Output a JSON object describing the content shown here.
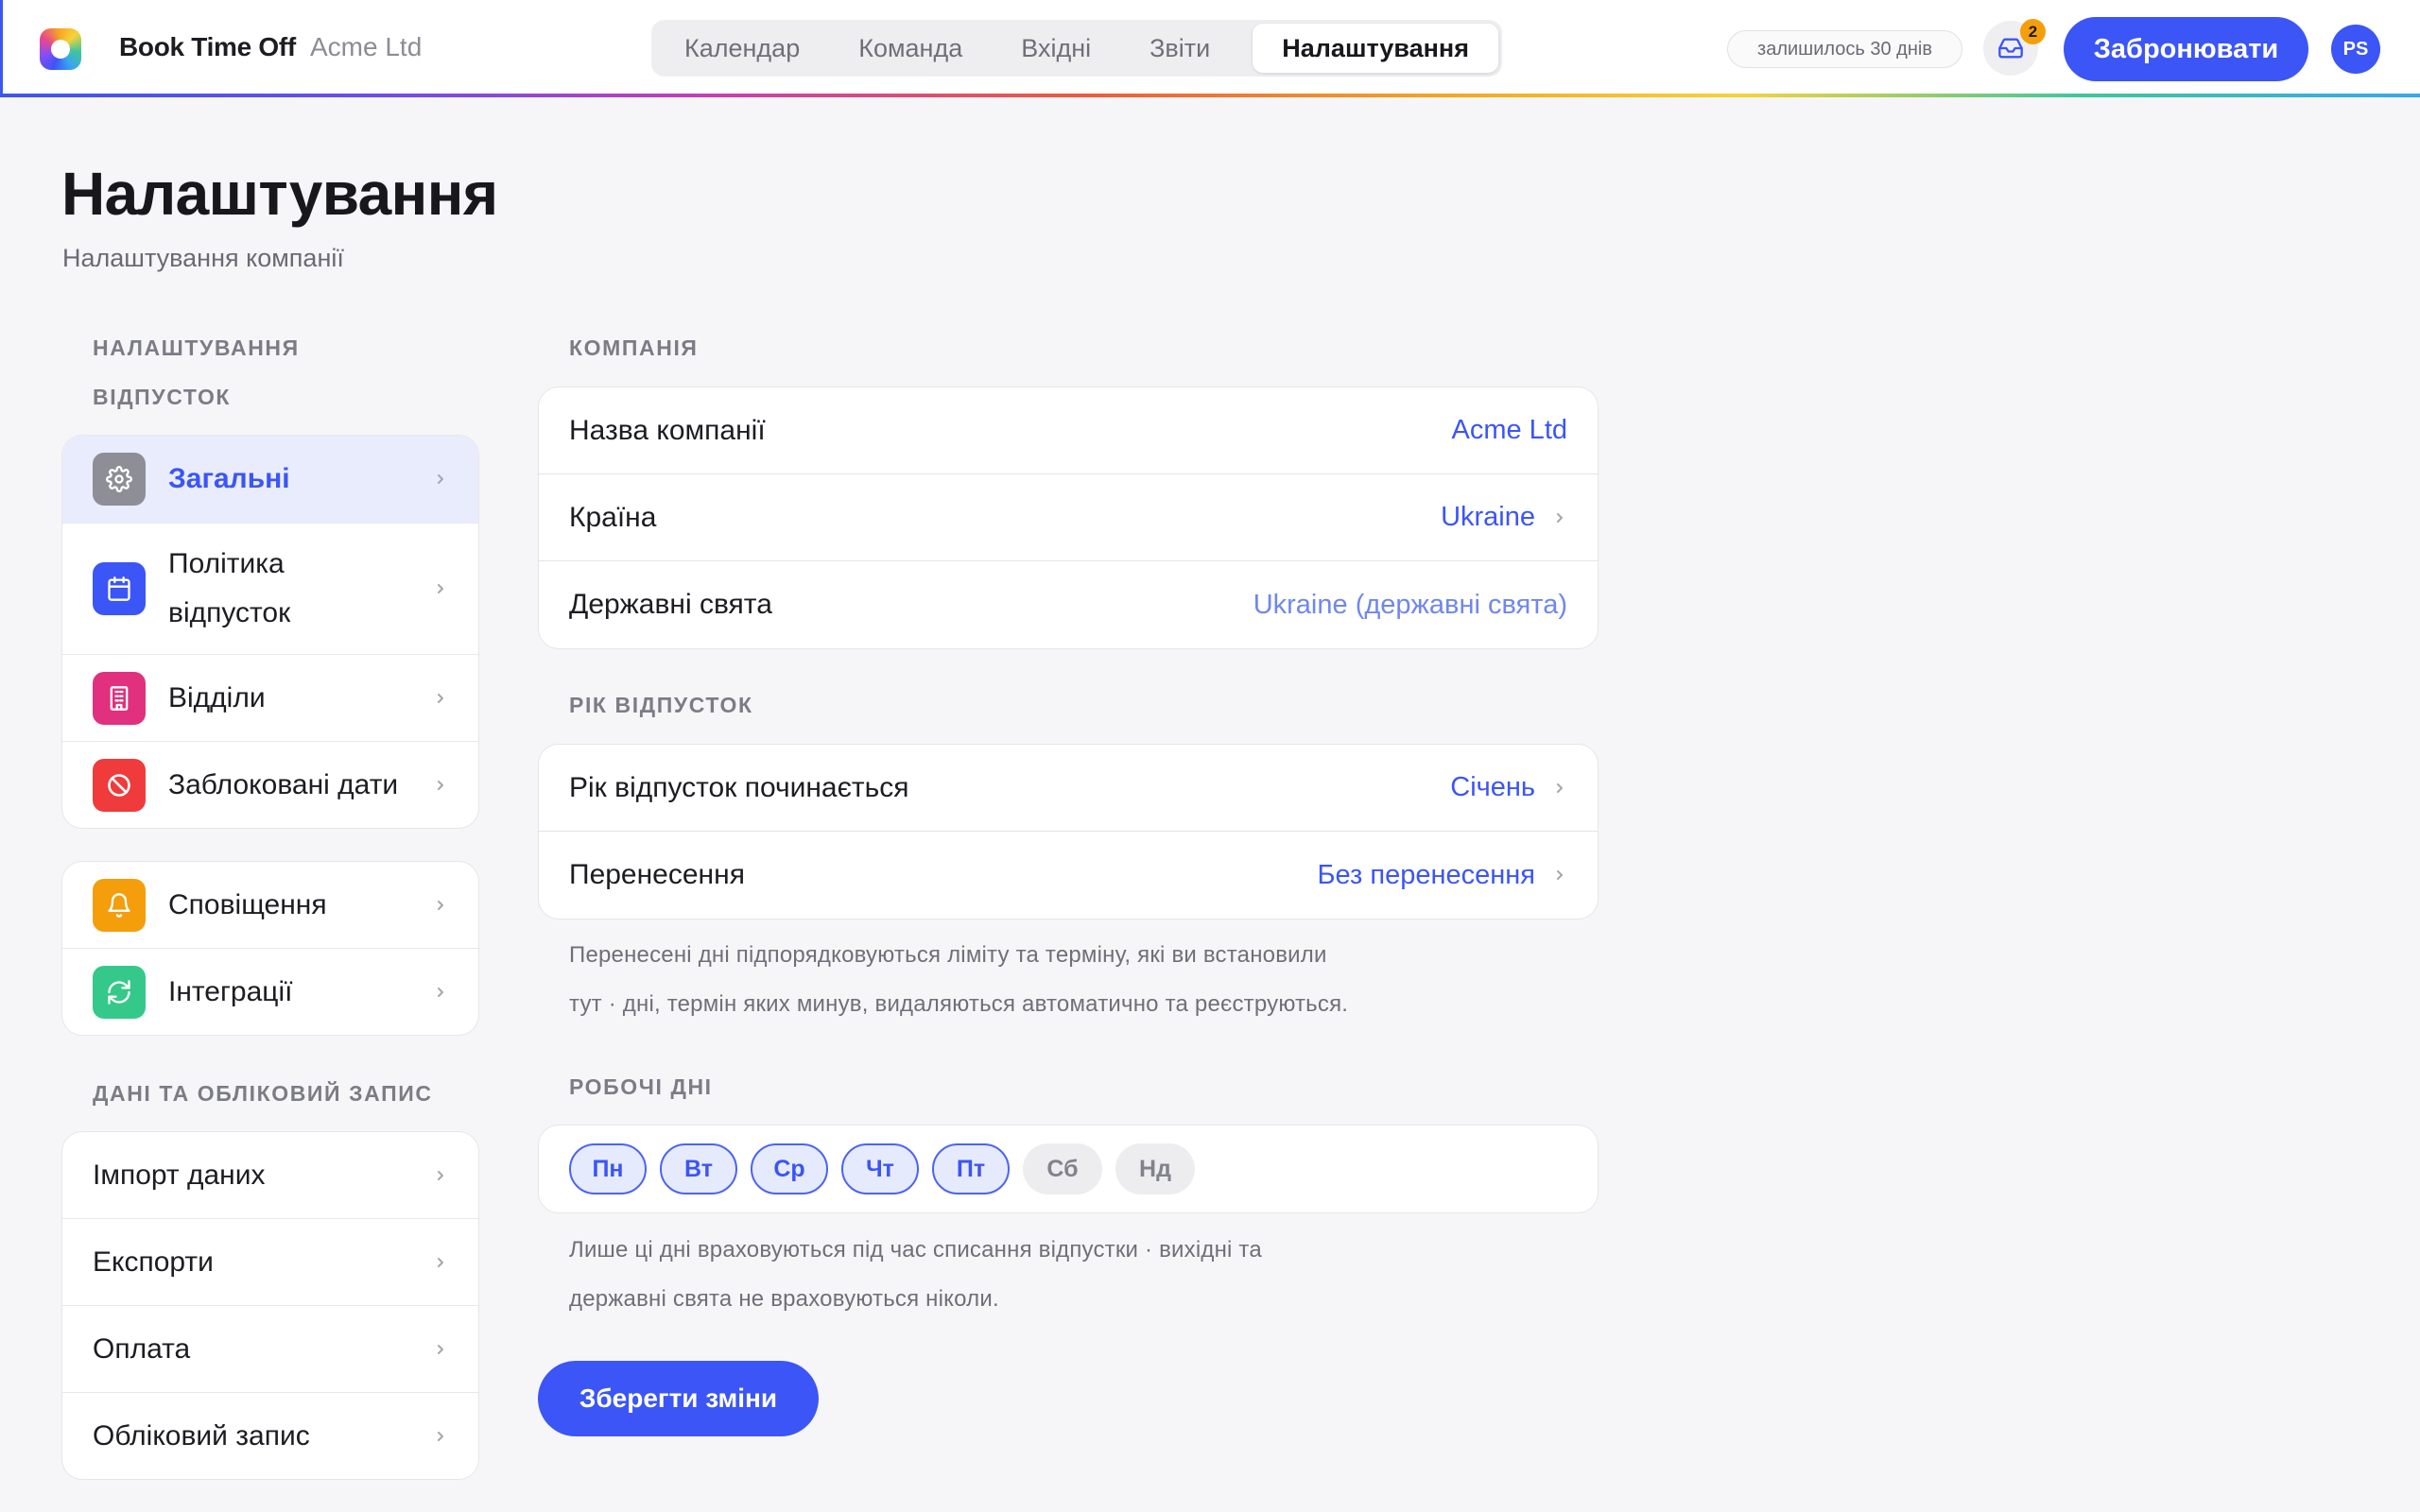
{
  "app": {
    "brand": "Book Time Off",
    "org": "Acme Ltd"
  },
  "nav": {
    "tabs": [
      "Календар",
      "Команда",
      "Вхідні",
      "Звіти",
      "Налаштування"
    ],
    "active": "Налаштування"
  },
  "header": {
    "trial": "залишилось 30 днів",
    "inbox_count": "2",
    "book_label": "Забронювати",
    "avatar_initials": "PS"
  },
  "page": {
    "title": "Налаштування",
    "subtitle": "Налаштування компанії"
  },
  "sidebar": {
    "section1_label": "НАЛАШТУВАННЯ ВІДПУСТОК",
    "group1": [
      {
        "label": "Загальні",
        "icon": "gear-icon",
        "color": "#8e8e96",
        "selected": true
      },
      {
        "label": "Політика відпусток",
        "icon": "calendar-icon",
        "color": "#3b55f6"
      },
      {
        "label": "Відділи",
        "icon": "building-icon",
        "color": "#e0307e"
      },
      {
        "label": "Заблоковані дати",
        "icon": "block-icon",
        "color": "#ef3b3b"
      }
    ],
    "group2": [
      {
        "label": "Сповіщення",
        "icon": "bell-icon",
        "color": "#f59e0b"
      },
      {
        "label": "Інтеграції",
        "icon": "sync-icon",
        "color": "#34c98a"
      }
    ],
    "section2_label": "ДАНІ ТА ОБЛІКОВИЙ ЗАПИС",
    "group3": [
      "Імпорт даних",
      "Експорти",
      "Оплата",
      "Обліковий запис"
    ]
  },
  "company": {
    "label": "КОМПАНІЯ",
    "name_label": "Назва компанії",
    "name_value": "Acme Ltd",
    "country_label": "Країна",
    "country_value": "Ukraine",
    "holidays_label": "Державні свята",
    "holidays_value": "Ukraine (державні свята)"
  },
  "leave_year": {
    "label": "РІК ВІДПУСТОК",
    "start_label": "Рік відпусток починається",
    "start_value": "Січень",
    "carry_label": "Перенесення",
    "carry_value": "Без перенесення",
    "note_line1": "Перенесені дні підпорядковуються ліміту та терміну, які ви встановили",
    "note_line2": "тут · дні, термін яких минув, видаляються автоматично та реєструються."
  },
  "work_days": {
    "label": "РОБОЧІ ДНІ",
    "days": [
      {
        "label": "Пн",
        "on": true
      },
      {
        "label": "Вт",
        "on": true
      },
      {
        "label": "Ср",
        "on": true
      },
      {
        "label": "Чт",
        "on": true
      },
      {
        "label": "Пт",
        "on": true
      },
      {
        "label": "Сб",
        "on": false
      },
      {
        "label": "Нд",
        "on": false
      }
    ],
    "note_line1": "Лише ці дні враховуються під час списання відпустки · вихідні та",
    "note_line2": "державні свята не враховуються ніколи."
  },
  "save_label": "Зберегти зміни",
  "colors": {
    "accent": "#3b55f6",
    "background": "#f6f6f8"
  }
}
